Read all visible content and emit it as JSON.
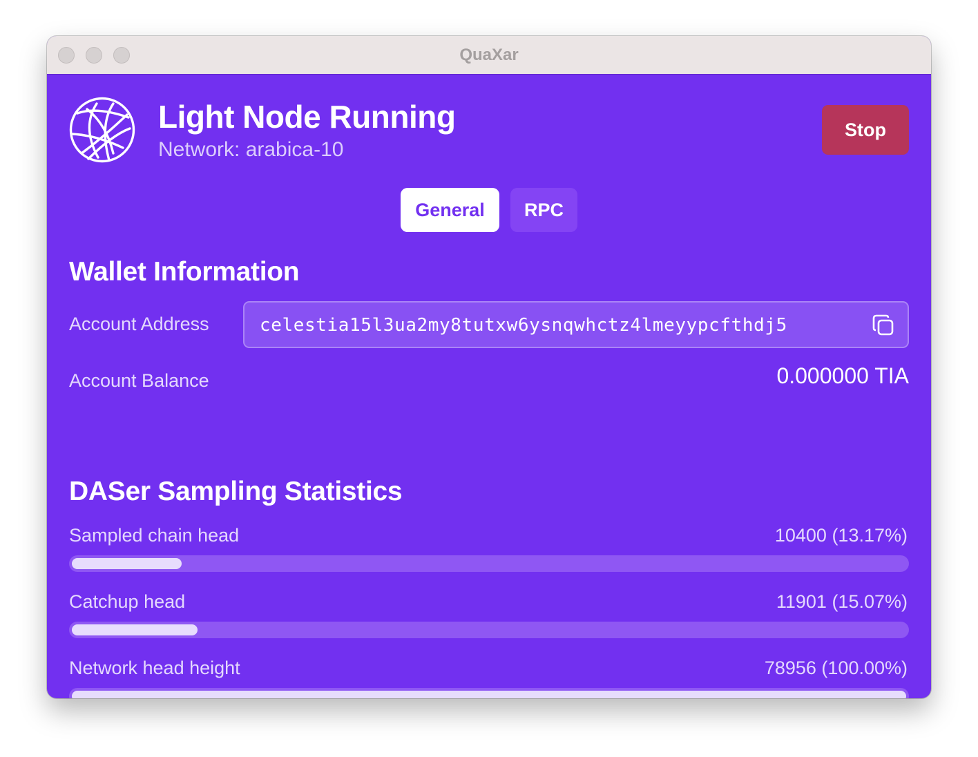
{
  "window": {
    "title": "QuaXar"
  },
  "header": {
    "title": "Light Node Running",
    "network": "Network: arabica-10",
    "stop_label": "Stop"
  },
  "tabs": [
    {
      "label": "General",
      "selected": true
    },
    {
      "label": "RPC",
      "selected": false
    }
  ],
  "wallet": {
    "section_title": "Wallet Information",
    "address_label": "Account Address",
    "address_value": "celestia15l3ua2my8tutxw6ysnqwhctz4lmeyypcfthdj5",
    "balance_label": "Account Balance",
    "balance_value": "0.000000 TIA"
  },
  "daser": {
    "section_title": "DASer Sampling Statistics",
    "stats": [
      {
        "label": "Sampled chain head",
        "value": "10400 (13.17%)",
        "fraction": 0.1317
      },
      {
        "label": "Catchup head",
        "value": "11901 (15.07%)",
        "fraction": 0.1507
      },
      {
        "label": "Network head height",
        "value": "78956 (100.00%)",
        "fraction": 1.0
      }
    ]
  },
  "icons": {
    "logo": "globe-network-icon",
    "copy": "copy-icon"
  },
  "colors": {
    "background": "#7230f0",
    "stop_button": "#b6355a",
    "tab_selected_bg": "#ffffff",
    "tab_unselected_bg": "#8444f4",
    "bar_fill": "#e7dcfd"
  }
}
